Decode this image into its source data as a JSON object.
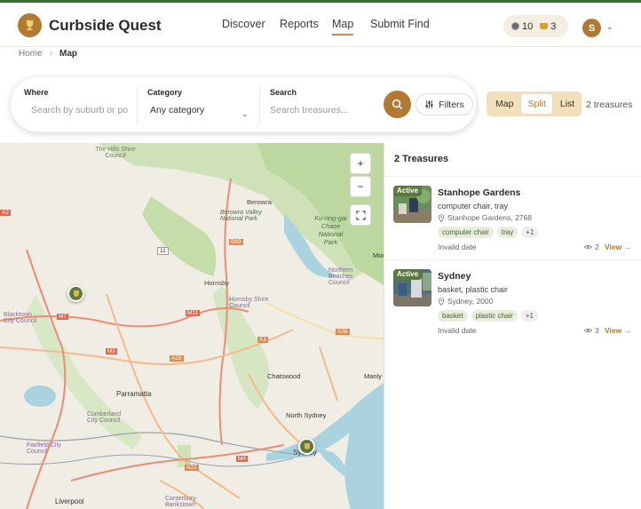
{
  "app": {
    "name": "Curbside Quest"
  },
  "nav": {
    "items": [
      "Discover",
      "Reports",
      "Map",
      "Submit Find"
    ],
    "active": "Map"
  },
  "user": {
    "coins": "10",
    "trophies": "3",
    "avatar_initial": "S"
  },
  "breadcrumb": {
    "home": "Home",
    "current": "Map"
  },
  "search": {
    "where_label": "Where",
    "where_placeholder": "Search by suburb or po",
    "category_label": "Category",
    "category_value": "Any category",
    "search_label": "Search",
    "search_placeholder": "Search treasures...",
    "filters_label": "Filters"
  },
  "view_toggle": {
    "options": [
      "Map",
      "Split",
      "List"
    ],
    "selected": "Split"
  },
  "result_count": "2 treasures",
  "map": {
    "zoom_in": "+",
    "zoom_out": "−",
    "labels": [
      "The Hills Shire Council",
      "Ku-ring-gai Chase National Park",
      "Berowra",
      "Berowra Valley National Park",
      "Hornsby",
      "Hornsby Shire Council",
      "Northern Beaches Council",
      "Blacktown City Council",
      "Parramatta",
      "Cumberland City Council",
      "Fairfield City Council",
      "Chatswood",
      "North Sydney",
      "Sydney",
      "Liverpool",
      "Canterbury-Bankstown",
      "Manly",
      "Mona"
    ],
    "roads": [
      "A2",
      "B83",
      "11",
      "M7",
      "M11",
      "M2",
      "A28",
      "A1",
      "A38",
      "M4",
      "A22"
    ]
  },
  "panel": {
    "title": "2 Treasures",
    "items": [
      {
        "status": "Active",
        "title": "Stanhope Gardens",
        "subtitle": "computer chair, tray",
        "location": "Stanhope Gardens, 2768",
        "tags": [
          "computer chair",
          "tray",
          "+1"
        ],
        "date": "Invalid date",
        "views": "2",
        "view_label": "View →"
      },
      {
        "status": "Active",
        "title": "Sydney",
        "subtitle": "basket, plastic chair",
        "location": "Sydney, 2000",
        "tags": [
          "basket",
          "plastic chair",
          "+1"
        ],
        "date": "Invalid date",
        "views": "3",
        "view_label": "View →"
      }
    ]
  },
  "colors": {
    "brand": "#b07a32",
    "accent_green": "#5c7a3e",
    "top_strip": "#3f6a3a"
  }
}
